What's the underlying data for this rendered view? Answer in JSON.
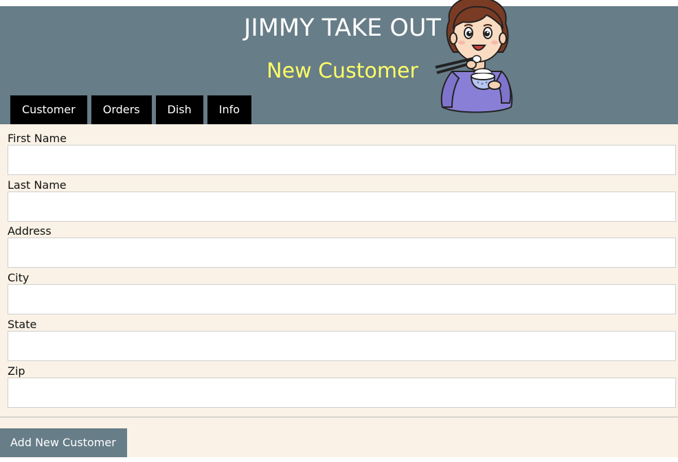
{
  "header": {
    "brand_title": "JIMMY TAKE OUT",
    "page_heading": "New Customer",
    "background_color": "#677d88",
    "heading_color": "#ffff66"
  },
  "nav": {
    "tabs": [
      {
        "label": "Customer"
      },
      {
        "label": "Orders"
      },
      {
        "label": "Dish"
      },
      {
        "label": "Info"
      }
    ]
  },
  "form": {
    "background_color": "#faf2e6",
    "fields": [
      {
        "label": "First Name",
        "value": "",
        "placeholder": ""
      },
      {
        "label": "Last Name",
        "value": "",
        "placeholder": ""
      },
      {
        "label": "Address",
        "value": "",
        "placeholder": ""
      },
      {
        "label": "City",
        "value": "",
        "placeholder": ""
      },
      {
        "label": "State",
        "value": "",
        "placeholder": ""
      },
      {
        "label": "Zip",
        "value": "",
        "placeholder": ""
      }
    ],
    "submit_label": "Add New Customer"
  },
  "mascot": {
    "icon": "girl-eating-rice-illustration"
  }
}
